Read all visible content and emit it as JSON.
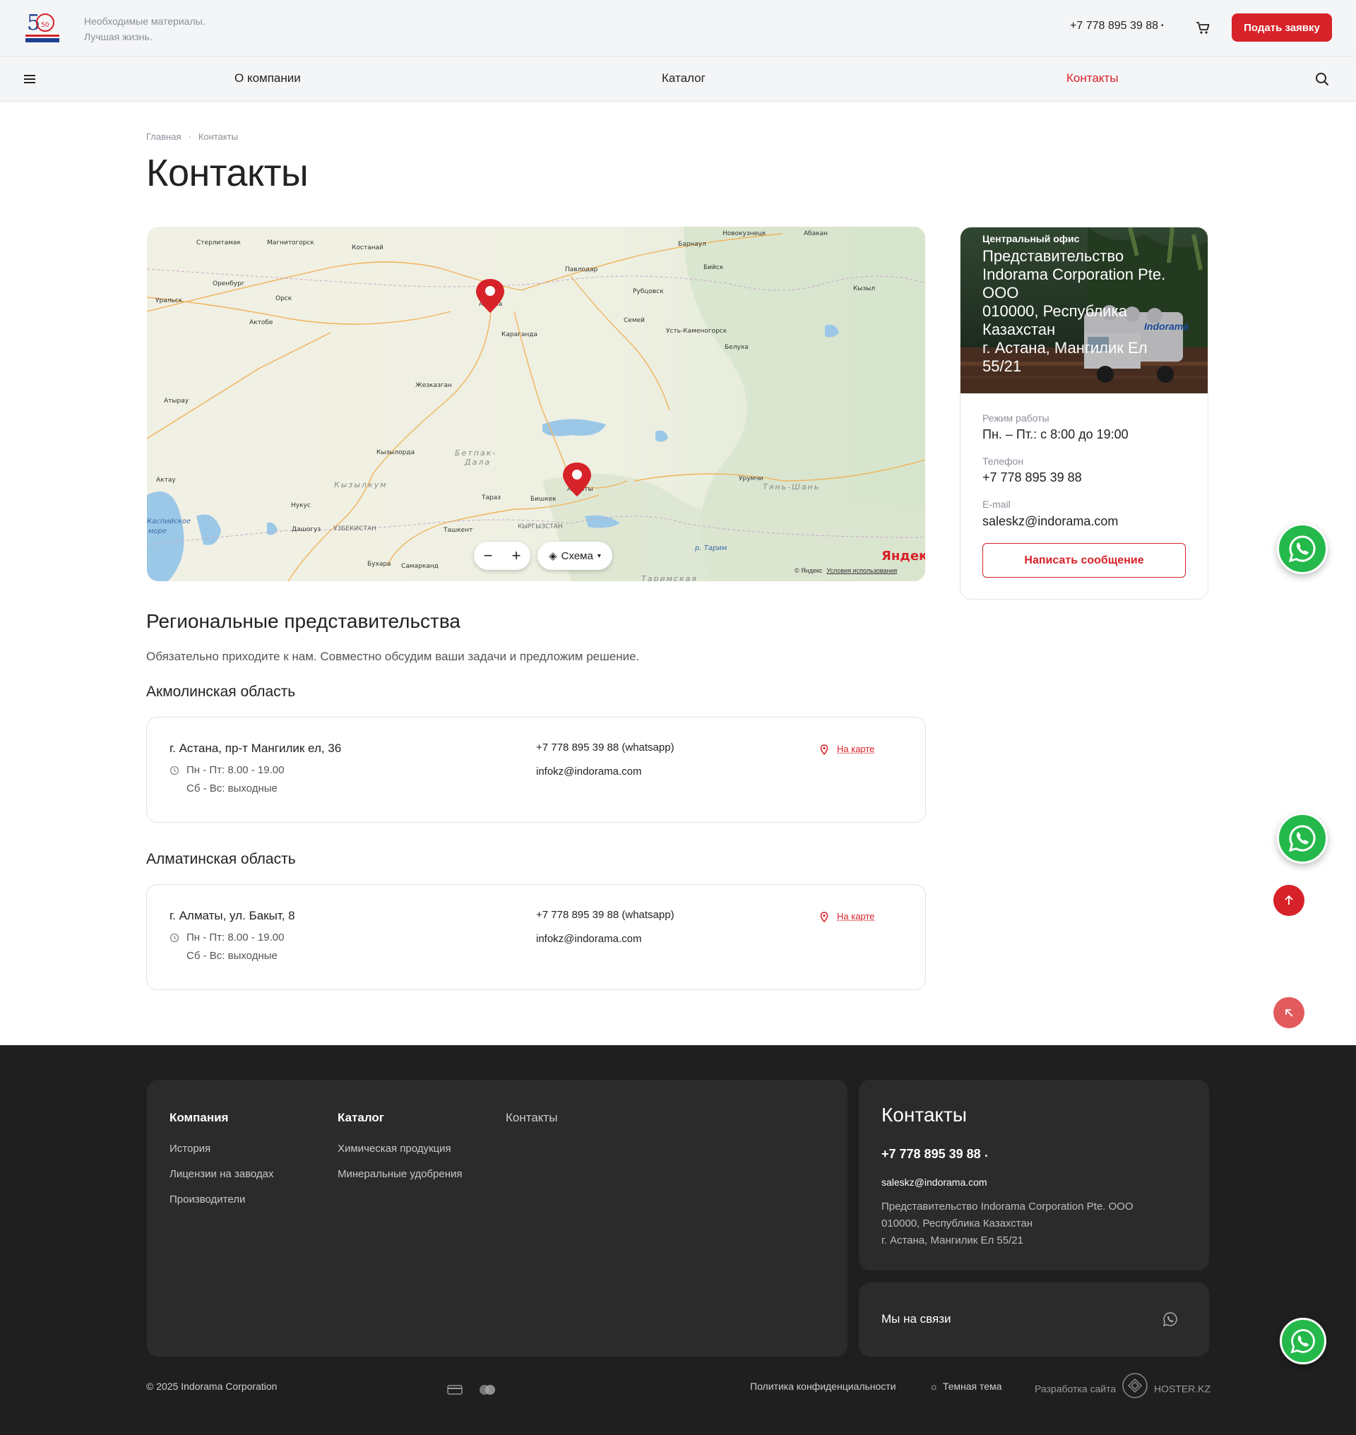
{
  "header": {
    "tagline_line1": "Необходимые материалы.",
    "tagline_line2": "Лучшая жизнь.",
    "phone": "+7 778 895 39 88",
    "request_button": "Подать заявку"
  },
  "nav": {
    "items": [
      {
        "label": "О компании"
      },
      {
        "label": "Каталог"
      },
      {
        "label": "Контакты",
        "active": true
      }
    ]
  },
  "breadcrumb": {
    "home": "Главная",
    "current": "Контакты"
  },
  "page_title": "Контакты",
  "map": {
    "zoom_out": "−",
    "zoom_in": "+",
    "layer": "Схема",
    "logo": "Яндекс",
    "attribution": "© Яндекс",
    "terms": "Условия использования",
    "cities": [
      "Стерлитамак",
      "Магнитогорск",
      "Костанай",
      "Новокузнецк",
      "Абакан",
      "Барнаул",
      "Бийск",
      "Павлодар",
      "Оренбург",
      "Орск",
      "Уральск",
      "Актобе",
      "Астана",
      "Рубцовск",
      "Семей",
      "Кызыл",
      "Усть-Каменогорск",
      "Белуха",
      "Караганда",
      "Жезказган",
      "Атырау",
      "Кызылорда",
      "Бетпак-Дала",
      "Кызылкум",
      "Актау",
      "Нукус",
      "Дашогуз",
      "Тараз",
      "Бишкек",
      "Алматы",
      "Урумчи",
      "Узбекистан",
      "Ташкент",
      "Кыргызстан",
      "Бухара",
      "Самарканд",
      "Таримская",
      "Каспийское море",
      "Тянь-Шань",
      "Тарим"
    ]
  },
  "office": {
    "label": "Центральный офис",
    "name_l1": "Представительство",
    "name_l2": "Indorama Corporation Pte.",
    "name_l3": "ООО",
    "name_l4": "010000, Республика",
    "name_l5": "Казахстан",
    "name_l6": "г. Астана, Мангилик Ел",
    "name_l7": "55/21",
    "hours_label": "Режим работы",
    "hours": "Пн. – Пт.: с 8:00 до 19:00",
    "phone_label": "Телефон",
    "phone": "+7 778 895 39 88",
    "email_label": "E-mail",
    "email": "saleskz@indorama.com",
    "message_button": "Написать сообщение",
    "truck_text": "Indorama"
  },
  "regional": {
    "title": "Региональные представительства",
    "description": "Обязательно приходите к нам. Совместно обсудим ваши задачи и предложим решение.",
    "regions": [
      {
        "name": "Акмолинская область",
        "address": "г. Астана, пр-т Мангилик ел, 36",
        "hours1": "Пн - Пт: 8.00 - 19.00",
        "hours2": "Сб - Вс: выходные",
        "phone": "+7 778 895 39 88 (whatsapp)",
        "email": "infokz@indorama.com",
        "map_link": "На карте"
      },
      {
        "name": "Алматинская область",
        "address": "г. Алматы, ул. Бакыт, 8",
        "hours1": "Пн - Пт: 8.00 - 19.00",
        "hours2": "Сб - Вс: выходные",
        "phone": "+7 778 895 39 88 (whatsapp)",
        "email": "infokz@indorama.com",
        "map_link": "На карте"
      }
    ]
  },
  "footer": {
    "col1_title": "Компания",
    "col1_links": [
      "История",
      "Лицензии на заводах",
      "Производители"
    ],
    "col2_title": "Каталог",
    "col2_links": [
      "Химическая продукция",
      "Минеральные удобрения"
    ],
    "col3_title": "Контакты",
    "contacts_title": "Контакты",
    "contacts_phone": "+7 778 895 39 88",
    "contacts_email": "saleskz@indorama.com",
    "contacts_addr1": "Представительство Indorama Corporation Pte. ООО",
    "contacts_addr2": "010000, Республика Казахстан",
    "contacts_addr3": "г. Астана, Мангилик Ел 55/21",
    "social_text": "Мы на связи",
    "copyright": "© 2025 Indorama Corporation",
    "privacy": "Политика конфиденциальности",
    "dark_theme": "Темная тема",
    "dev_label": "Разработка сайта",
    "dev_name": "HOSTER.KZ"
  },
  "colors": {
    "accent": "#d72229",
    "whatsapp": "#24b94a",
    "footer_bg": "#1f1f1f"
  }
}
